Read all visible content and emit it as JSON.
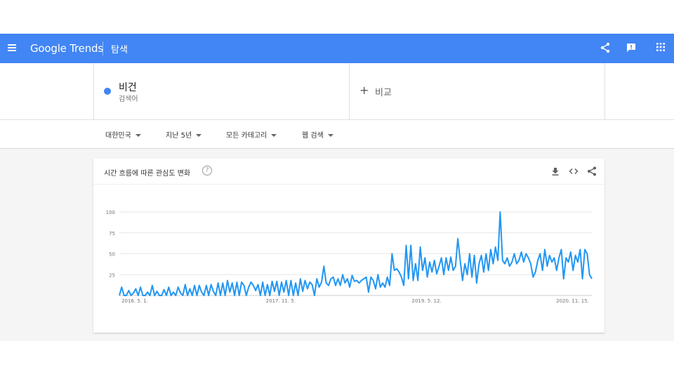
{
  "header": {
    "menu_icon": "hamburger-menu-icon",
    "logo_google": "Google",
    "logo_trends": "Trends",
    "page_title": "탐색",
    "share_icon": "share-icon",
    "feedback_icon": "feedback-icon",
    "apps_icon": "apps-grid-icon"
  },
  "search_term": {
    "name": "비건",
    "type": "검색어",
    "color": "#4285f4"
  },
  "compare": {
    "label": "비교",
    "icon": "plus-icon"
  },
  "filters": {
    "region": "대한민국",
    "time": "지난 5년",
    "category": "모든 카테고리",
    "search_type": "웹 검색"
  },
  "card": {
    "title": "시간 흐름에 따른 관심도 변화",
    "help_glyph": "?",
    "download_icon": "download-icon",
    "embed_icon": "embed-code-icon",
    "share_icon": "share-icon"
  },
  "chart_data": {
    "type": "line",
    "title": "",
    "xlabel": "",
    "ylabel": "",
    "ylim": [
      0,
      100
    ],
    "yticks": [
      25,
      50,
      75,
      100
    ],
    "xticks": [
      "2016. 5. 1.",
      "2017. 11. 5.",
      "2019. 5. 12.",
      "2020. 11. 15."
    ],
    "line_color": "#2196f3",
    "grid": true,
    "series": [
      {
        "values": [
          0,
          10,
          0,
          0,
          6,
          0,
          3,
          8,
          0,
          10,
          0,
          0,
          4,
          0,
          12,
          0,
          5,
          0,
          0,
          7,
          0,
          10,
          0,
          4,
          0,
          10,
          3,
          0,
          13,
          0,
          8,
          0,
          12,
          0,
          12,
          4,
          0,
          12,
          0,
          13,
          5,
          0,
          15,
          0,
          15,
          0,
          18,
          4,
          15,
          0,
          16,
          0,
          16,
          12,
          0,
          10,
          16,
          12,
          6,
          13,
          0,
          16,
          0,
          13,
          0,
          17,
          5,
          17,
          0,
          16,
          4,
          18,
          0,
          18,
          0,
          15,
          0,
          20,
          5,
          18,
          8,
          16,
          13,
          0,
          20,
          10,
          16,
          35,
          15,
          12,
          20,
          22,
          12,
          20,
          12,
          25,
          15,
          20,
          10,
          24,
          17,
          18,
          15,
          18,
          20,
          22,
          4,
          22,
          18,
          8,
          25,
          10,
          15,
          10,
          22,
          12,
          50,
          30,
          32,
          28,
          22,
          12,
          60,
          20,
          60,
          18,
          38,
          18,
          58,
          30,
          45,
          22,
          40,
          28,
          42,
          26,
          35,
          45,
          25,
          45,
          30,
          46,
          30,
          35,
          68,
          42,
          18,
          38,
          25,
          50,
          22,
          48,
          15,
          38,
          48,
          28,
          50,
          30,
          55,
          38,
          58,
          42,
          100,
          42,
          38,
          45,
          35,
          40,
          50,
          38,
          42,
          52,
          40,
          50,
          45,
          38,
          22,
          28,
          42,
          50,
          30,
          55,
          35,
          48,
          40,
          45,
          30,
          45,
          55,
          20,
          45,
          40,
          52,
          30,
          48,
          40,
          55,
          20,
          55,
          50,
          25,
          20
        ]
      }
    ]
  }
}
